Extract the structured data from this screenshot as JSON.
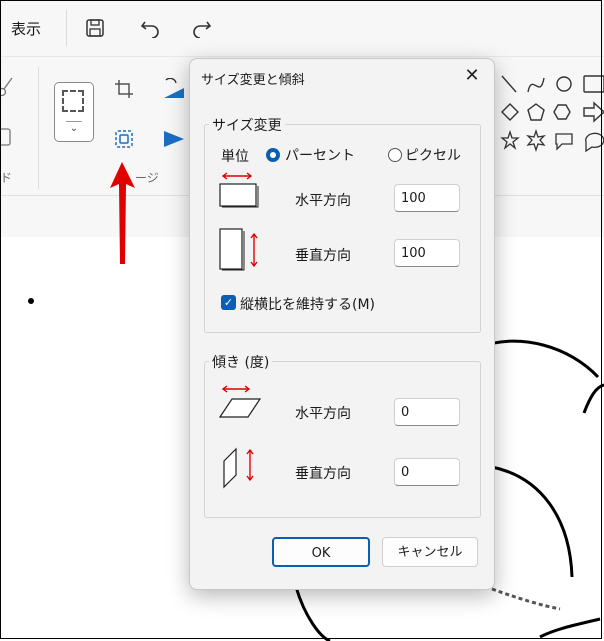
{
  "menu": {
    "view_label": "表示"
  },
  "ribbon": {
    "image_group_label": "ージ",
    "clipboard_group_label": "ド"
  },
  "dialog": {
    "title": "サイズ変更と傾斜",
    "resize": {
      "title": "サイズ変更",
      "unit_label": "単位",
      "percent_label": "パーセント",
      "pixel_label": "ピクセル",
      "unit_selected": "パーセント",
      "horizontal_label": "水平方向",
      "horizontal_value": "100",
      "vertical_label": "垂直方向",
      "vertical_value": "100",
      "keep_ratio_label": "縦横比を維持する(M)",
      "keep_ratio_checked": true
    },
    "skew": {
      "title": "傾き (度)",
      "horizontal_label": "水平方向",
      "horizontal_value": "0",
      "vertical_label": "垂直方向",
      "vertical_value": "0"
    },
    "ok_label": "OK",
    "cancel_label": "キャンセル",
    "accent_color": "#0a5fb4",
    "arrow_color": "#e00000"
  }
}
